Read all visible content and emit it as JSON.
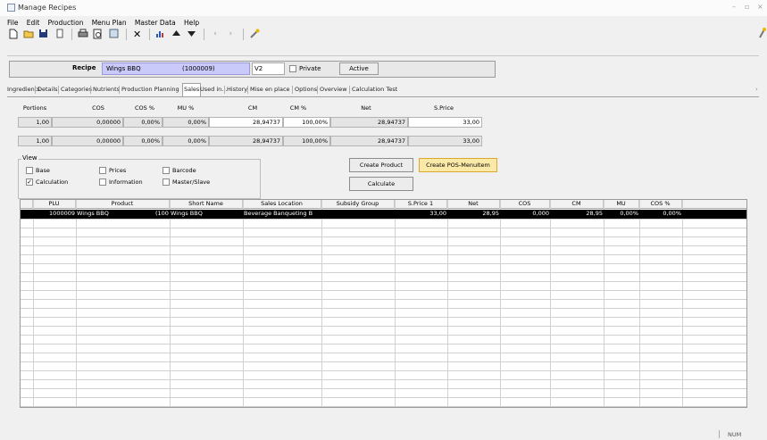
{
  "window": {
    "title": "Manage Recipes"
  },
  "menu": [
    "File",
    "Edit",
    "Production",
    "Menu Plan",
    "Master Data",
    "Help"
  ],
  "header": {
    "recipe_label": "Recipe",
    "recipe_name": "Wings BBQ",
    "recipe_no": "(1000009)",
    "version": "V2",
    "private_label": "Private",
    "active_label": "Active"
  },
  "tabs": [
    "Ingredients",
    "Details",
    "Categories",
    "Nutrients",
    "Production Planning",
    "Sales",
    "Used in...",
    "History",
    "Mise en place",
    "Options",
    "Overview",
    "Calculation Test"
  ],
  "active_tab": "Sales",
  "calc": {
    "headers": [
      "Portions",
      "COS",
      "COS %",
      "MU %",
      "CM",
      "CM %",
      "Net",
      "S.Price"
    ],
    "rows": [
      [
        "1,00",
        "0,00000",
        "0,00%",
        "0,00%",
        "28,94737",
        "100,00%",
        "28,94737",
        "33,00"
      ],
      [
        "1,00",
        "0,00000",
        "0,00%",
        "0,00%",
        "28,94737",
        "100,00%",
        "28,94737",
        "33,00"
      ]
    ]
  },
  "view": {
    "title": "View",
    "options": [
      {
        "label": "Base",
        "checked": false
      },
      {
        "label": "Prices",
        "checked": false
      },
      {
        "label": "Barcode",
        "checked": false
      },
      {
        "label": "Calculation",
        "checked": true
      },
      {
        "label": "Information",
        "checked": false
      },
      {
        "label": "Master/Slave",
        "checked": false
      }
    ]
  },
  "buttons": {
    "create_product": "Create Product",
    "create_pos": "Create POS-MenuItem",
    "calculate": "Calculate"
  },
  "table": {
    "headers": [
      "PLU",
      "Product",
      "Short Name",
      "Sales Location",
      "Subsidy Group",
      "S.Price 1",
      "Net",
      "COS",
      "CM",
      "MU",
      "COS %"
    ],
    "rows": [
      [
        "1000009",
        "Wings BBQ",
        "(100",
        "Wings BBQ",
        "Beverage Banqueting B",
        "",
        "33,00",
        "28,95",
        "0,000",
        "28,95",
        "0,00%",
        "0,00%"
      ]
    ]
  },
  "status": {
    "num": "NUM"
  },
  "toolbar_icons": [
    "new-icon",
    "open-icon",
    "save-icon",
    "copy-icon",
    "print-icon",
    "preview-icon",
    "export-icon",
    "delete-icon",
    "chart-icon",
    "up-arrow-icon",
    "down-arrow-icon",
    "undo-icon",
    "redo-icon",
    "settings-icon"
  ]
}
